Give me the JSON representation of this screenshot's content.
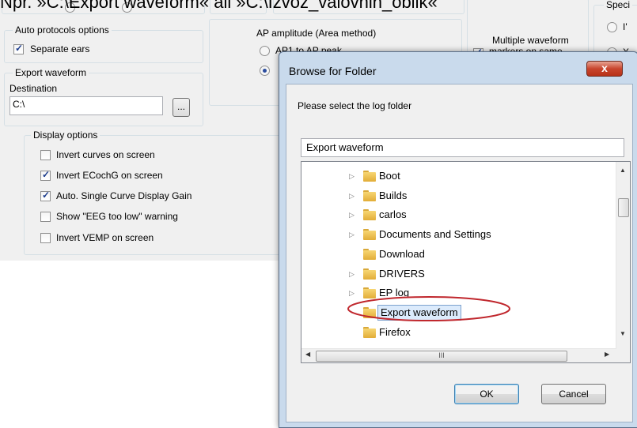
{
  "caption": "Npr. »C:\\Export waveform« ali »C:\\Izvoz_valovnih_oblik«",
  "auto_protocols": {
    "title": "Auto protocols options",
    "separate_ears": "Separate ears"
  },
  "export_waveform": {
    "title": "Export waveform",
    "destination_label": "Destination",
    "destination_value": "C:\\",
    "browse_button": "..."
  },
  "display_options": {
    "title": "Display options",
    "items": [
      {
        "label": "Invert curves on screen",
        "checked": false
      },
      {
        "label": "Invert ECochG on screen",
        "checked": true
      },
      {
        "label": "Auto. Single Curve Display Gain",
        "checked": true
      },
      {
        "label": "Show \"EEG too low\" warning",
        "checked": false
      },
      {
        "label": "Invert VEMP on screen",
        "checked": false
      }
    ]
  },
  "ap_amplitude": {
    "title": "AP amplitude (Area method)",
    "option1": "AP1 to AP peak"
  },
  "multiple_waveform": {
    "label_line1": "Multiple waveform",
    "label_line2": "markers on same"
  },
  "right_panel": {
    "title_partial": "Speci",
    "radio1": "I'",
    "radio2": "X"
  },
  "dialog": {
    "title": "Browse for Folder",
    "close_glyph": "x",
    "prompt": "Please select the log folder",
    "folder_field": "Export waveform",
    "tree": [
      {
        "name": "Boot",
        "expandable": true,
        "selected": false
      },
      {
        "name": "Builds",
        "expandable": true,
        "selected": false
      },
      {
        "name": "carlos",
        "expandable": true,
        "selected": false
      },
      {
        "name": "Documents and Settings",
        "expandable": true,
        "selected": false
      },
      {
        "name": "Download",
        "expandable": false,
        "selected": false
      },
      {
        "name": "DRIVERS",
        "expandable": true,
        "selected": false
      },
      {
        "name": "EP log",
        "expandable": true,
        "selected": false
      },
      {
        "name": "Export waveform",
        "expandable": false,
        "selected": true
      },
      {
        "name": "Firefox",
        "expandable": false,
        "selected": false
      }
    ],
    "scroll_grip": "III",
    "ok_button": "OK",
    "cancel_button": "Cancel"
  }
}
